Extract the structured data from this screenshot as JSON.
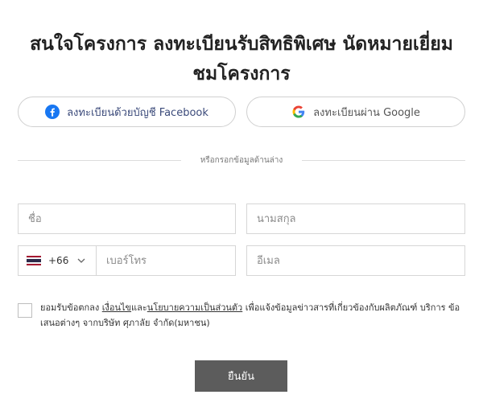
{
  "page": {
    "title_line1": "สนใจโครงการ ลงทะเบียนรับสิทธิพิเศษ นัดหมายเยี่ยม",
    "title_line2": "ชมโครงการ"
  },
  "social": {
    "facebook_label": "ลงทะเบียนด้วยบัญชี Facebook",
    "google_label": "ลงทะเบียนผ่าน Google"
  },
  "divider_text": "หรือกรอกข้อมูลด้านล่าง",
  "form": {
    "first_name_placeholder": "ชื่อ",
    "last_name_placeholder": "นามสกุล",
    "country_code": "+66",
    "phone_placeholder": "เบอร์โทร",
    "email_placeholder": "อีเมล"
  },
  "consent": {
    "prefix": "ยอมรับข้อตกลง ",
    "terms_link": "เงื่อนไข",
    "and": "และ",
    "privacy_link": "นโยบายความเป็นส่วนตัว",
    "suffix": " เพื่อแจ้งข้อมูลข่าวสารที่เกี่ยวข้องกับผลิตภัณฑ์ บริการ ข้อเสนอต่างๆ จากบริษัท ศุภาลัย จำกัด(มหาชน)"
  },
  "submit_label": "ยืนยัน",
  "icons": {
    "facebook": "facebook-icon",
    "google": "google-icon",
    "flag": "thailand-flag-icon",
    "dropdown": "chevron-down-icon"
  },
  "colors": {
    "facebook_blue": "#1877f2",
    "button_gray": "#5c5c5c",
    "border": "#d6d6d6"
  }
}
